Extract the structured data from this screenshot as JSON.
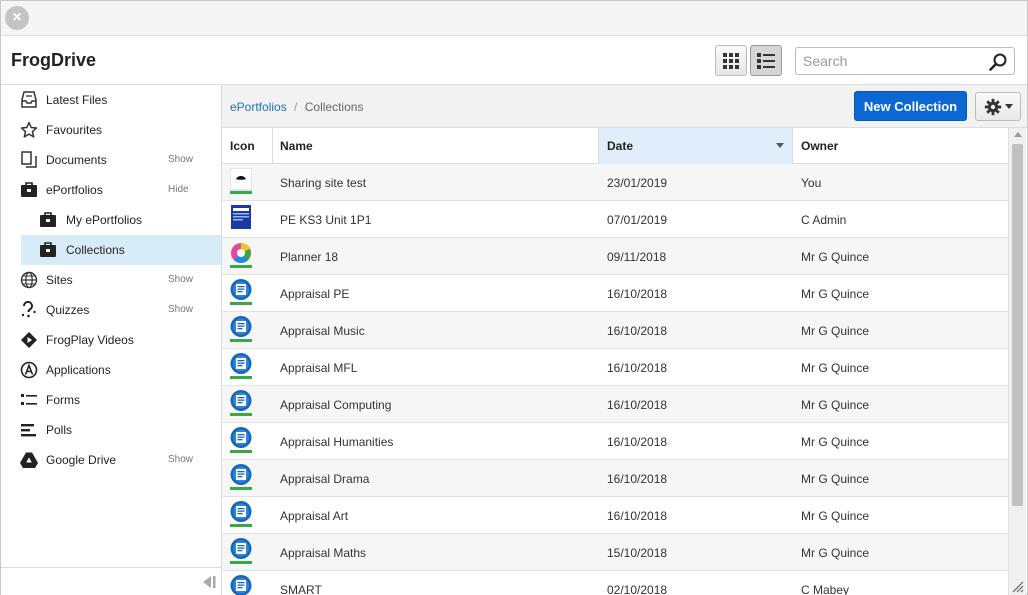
{
  "app": {
    "title": "FrogDrive"
  },
  "search": {
    "placeholder": "Search"
  },
  "sidebar": {
    "items": [
      {
        "label": "Latest Files",
        "action": "",
        "icon": "inbox-tray-icon"
      },
      {
        "label": "Favourites",
        "action": "",
        "icon": "star-icon"
      },
      {
        "label": "Documents",
        "action": "Show",
        "icon": "documents-icon"
      },
      {
        "label": "ePortfolios",
        "action": "Hide",
        "icon": "briefcase-icon"
      },
      {
        "label": "My ePortfolios",
        "action": "",
        "icon": "briefcase-icon"
      },
      {
        "label": "Collections",
        "action": "",
        "icon": "briefcase-icon"
      },
      {
        "label": "Sites",
        "action": "Show",
        "icon": "globe-icon"
      },
      {
        "label": "Quizzes",
        "action": "Show",
        "icon": "quiz-icon"
      },
      {
        "label": "FrogPlay Videos",
        "action": "",
        "icon": "frogplay-icon"
      },
      {
        "label": "Applications",
        "action": "",
        "icon": "applications-icon"
      },
      {
        "label": "Forms",
        "action": "",
        "icon": "forms-icon"
      },
      {
        "label": "Polls",
        "action": "",
        "icon": "polls-icon"
      },
      {
        "label": "Google Drive",
        "action": "Show",
        "icon": "google-drive-icon"
      }
    ]
  },
  "breadcrumb": {
    "parent": "ePortfolios",
    "separator": "/",
    "current": "Collections"
  },
  "toolbar": {
    "new_collection_label": "New Collection"
  },
  "table": {
    "headers": {
      "icon": "Icon",
      "name": "Name",
      "date": "Date",
      "owner": "Owner"
    },
    "rows": [
      {
        "name": "Sharing site test",
        "date": "23/01/2019",
        "owner": "You",
        "thumb": "site"
      },
      {
        "name": "PE KS3 Unit 1P1",
        "date": "07/01/2019",
        "owner": "C Admin",
        "thumb": "poster"
      },
      {
        "name": "Planner 18",
        "date": "09/11/2018",
        "owner": "Mr G Quince",
        "thumb": "wheel"
      },
      {
        "name": "Appraisal PE",
        "date": "16/10/2018",
        "owner": "Mr G Quince",
        "thumb": "appraisal"
      },
      {
        "name": "Appraisal Music",
        "date": "16/10/2018",
        "owner": "Mr G Quince",
        "thumb": "appraisal"
      },
      {
        "name": "Appraisal MFL",
        "date": "16/10/2018",
        "owner": "Mr G Quince",
        "thumb": "appraisal"
      },
      {
        "name": "Appraisal Computing",
        "date": "16/10/2018",
        "owner": "Mr G Quince",
        "thumb": "appraisal"
      },
      {
        "name": "Appraisal Humanities",
        "date": "16/10/2018",
        "owner": "Mr G Quince",
        "thumb": "appraisal"
      },
      {
        "name": "Appraisal Drama",
        "date": "16/10/2018",
        "owner": "Mr G Quince",
        "thumb": "appraisal"
      },
      {
        "name": "Appraisal Art",
        "date": "16/10/2018",
        "owner": "Mr G Quince",
        "thumb": "appraisal"
      },
      {
        "name": "Appraisal Maths",
        "date": "15/10/2018",
        "owner": "Mr G Quince",
        "thumb": "appraisal"
      },
      {
        "name": "SMART",
        "date": "02/10/2018",
        "owner": "C Mabey",
        "thumb": "appraisal"
      }
    ]
  },
  "colors": {
    "accent": "#0b67d1",
    "selected_bg": "#d8ecf8",
    "link": "#1f6fc5",
    "thumb_blue": "#1565c0",
    "thumb_green": "#3aa845"
  }
}
